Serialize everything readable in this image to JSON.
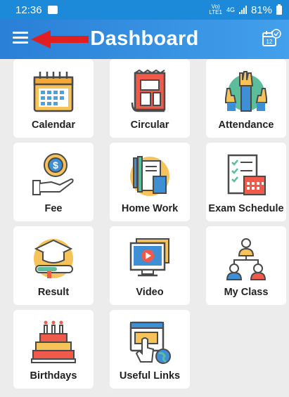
{
  "status_bar": {
    "time": "12:36",
    "network_top": "Vo)",
    "network_bottom": "LTE1",
    "signal_type": "4G",
    "battery": "81%"
  },
  "app_bar": {
    "title": "Dashboard",
    "calendar_day": "12"
  },
  "tiles": [
    {
      "label": "Calendar",
      "icon": "calendar-icon"
    },
    {
      "label": "Circular",
      "icon": "circular-icon"
    },
    {
      "label": "Attendance",
      "icon": "attendance-icon"
    },
    {
      "label": "Fee",
      "icon": "fee-icon"
    },
    {
      "label": "Home Work",
      "icon": "homework-icon"
    },
    {
      "label": "Exam Schedule",
      "icon": "exam-schedule-icon"
    },
    {
      "label": "Result",
      "icon": "result-icon"
    },
    {
      "label": "Video",
      "icon": "video-icon"
    },
    {
      "label": "My Class",
      "icon": "my-class-icon"
    },
    {
      "label": "Birthdays",
      "icon": "birthdays-icon"
    },
    {
      "label": "Useful Links",
      "icon": "useful-links-icon"
    }
  ],
  "colors": {
    "app_bar": "#2a7fd6",
    "status_bar": "#1d8ad9",
    "arrow": "#e02020",
    "background": "#ececec"
  }
}
